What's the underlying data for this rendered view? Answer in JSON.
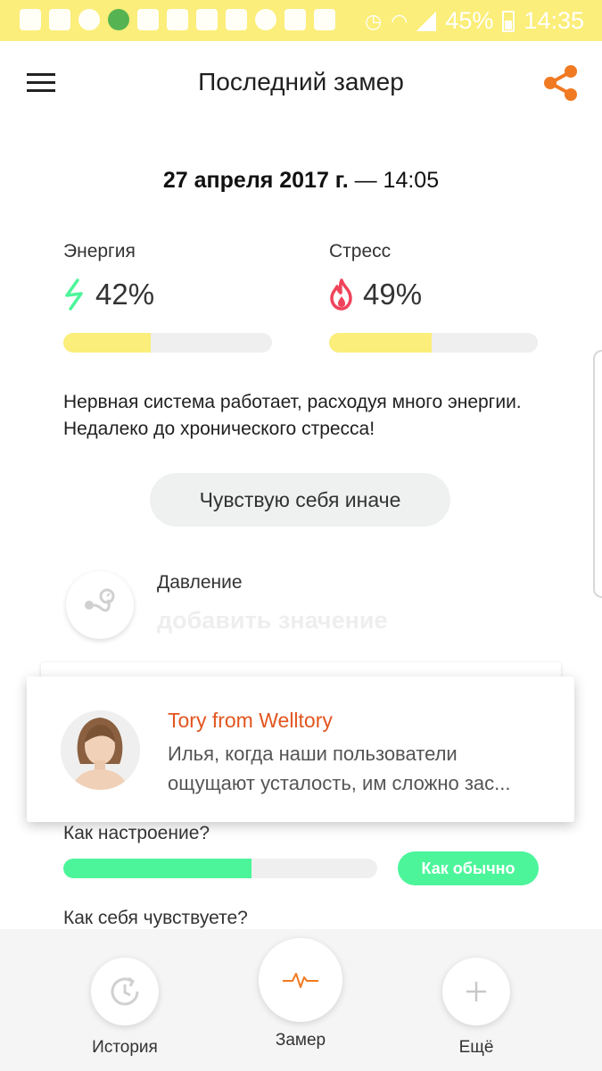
{
  "status_bar": {
    "battery": "45%",
    "time": "14:35"
  },
  "header": {
    "title": "Последний замер"
  },
  "measurement": {
    "date": "27 апреля 2017 г.",
    "time_sep": " — 14:05"
  },
  "energy": {
    "label": "Энергия",
    "value": "42%",
    "level": 0.42,
    "color": "#4cf59a"
  },
  "stress": {
    "label": "Стресс",
    "value": "49%",
    "level": 0.49,
    "color": "#f0435a"
  },
  "description": "Нервная система работает, расходуя много энергии. Недалеко до хронического стресса!",
  "feel_button": "Чувствую себя иначе",
  "pressure": {
    "label": "Давление",
    "placeholder": "добавить значение"
  },
  "notification": {
    "sender": "Tory from Welltory",
    "message": "Илья, когда наши пользователи ощущают усталость, им сложно зас..."
  },
  "mood": {
    "label": "Как настроение?",
    "level": 0.6,
    "button": "Как обычно"
  },
  "feeling_label": "Как себя чувствуете?",
  "bottom_nav": {
    "history": "История",
    "measure": "Замер",
    "more": "Ещё"
  },
  "colors": {
    "accent_orange": "#f07a22",
    "yellow": "#fbee7a",
    "green": "#4cf59a",
    "brand_text": "#e2551f"
  }
}
